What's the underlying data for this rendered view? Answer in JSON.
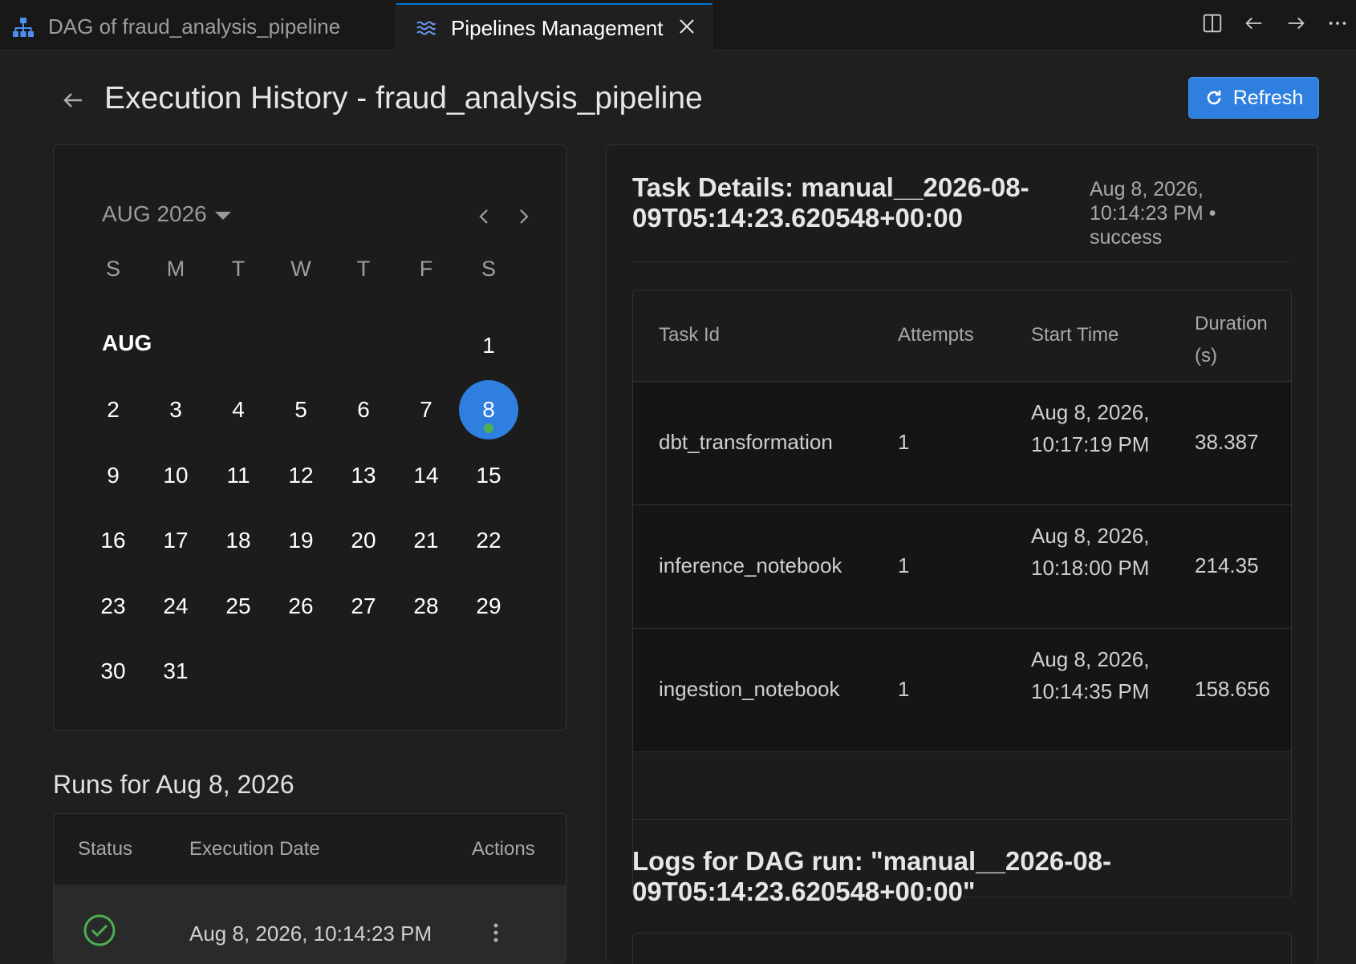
{
  "tabs": [
    {
      "label": "DAG of fraud_analysis_pipeline",
      "icon": "hierarchy-icon",
      "active": false
    },
    {
      "label": "Pipelines Management",
      "icon": "waves-icon",
      "active": true
    }
  ],
  "header": {
    "title": "Execution History - fraud_analysis_pipeline",
    "refresh_label": "Refresh"
  },
  "calendar": {
    "month_label": "AUG 2026",
    "weekdays": [
      "S",
      "M",
      "T",
      "W",
      "T",
      "F",
      "S"
    ],
    "month_short": "AUG",
    "days": [
      "1",
      "2",
      "3",
      "4",
      "5",
      "6",
      "7",
      "8",
      "9",
      "10",
      "11",
      "12",
      "13",
      "14",
      "15",
      "16",
      "17",
      "18",
      "19",
      "20",
      "21",
      "22",
      "23",
      "24",
      "25",
      "26",
      "27",
      "28",
      "29",
      "30",
      "31"
    ],
    "selected_day": "8"
  },
  "runs": {
    "title": "Runs for Aug 8, 2026",
    "headers": {
      "status": "Status",
      "date": "Execution Date",
      "actions": "Actions"
    },
    "rows": [
      {
        "status": "success",
        "date": "Aug 8, 2026, 10:14:23 PM"
      }
    ]
  },
  "task_details": {
    "title": "Task Details: manual__2026-08-09T05:14:23.620548+00:00",
    "meta": "Aug 8, 2026, 10:14:23 PM • success",
    "headers": {
      "task_id": "Task Id",
      "attempts": "Attempts",
      "start_time": "Start Time",
      "duration": "Duration (s)"
    },
    "rows": [
      {
        "task_id": "dbt_transformation",
        "attempts": "1",
        "start_time": "Aug 8, 2026, 10:17:19 PM",
        "duration": "38.387"
      },
      {
        "task_id": "inference_notebook",
        "attempts": "1",
        "start_time": "Aug 8, 2026, 10:18:00 PM",
        "duration": "214.35"
      },
      {
        "task_id": "ingestion_notebook",
        "attempts": "1",
        "start_time": "Aug 8, 2026, 10:14:35 PM",
        "duration": "158.656"
      }
    ]
  },
  "logs": {
    "title": "Logs for DAG run: \"manual__2026-08-09T05:14:23.620548+00:00\""
  },
  "colors": {
    "accent": "#2f7fe0",
    "success": "#4caf50",
    "background": "#1f1f1f"
  }
}
